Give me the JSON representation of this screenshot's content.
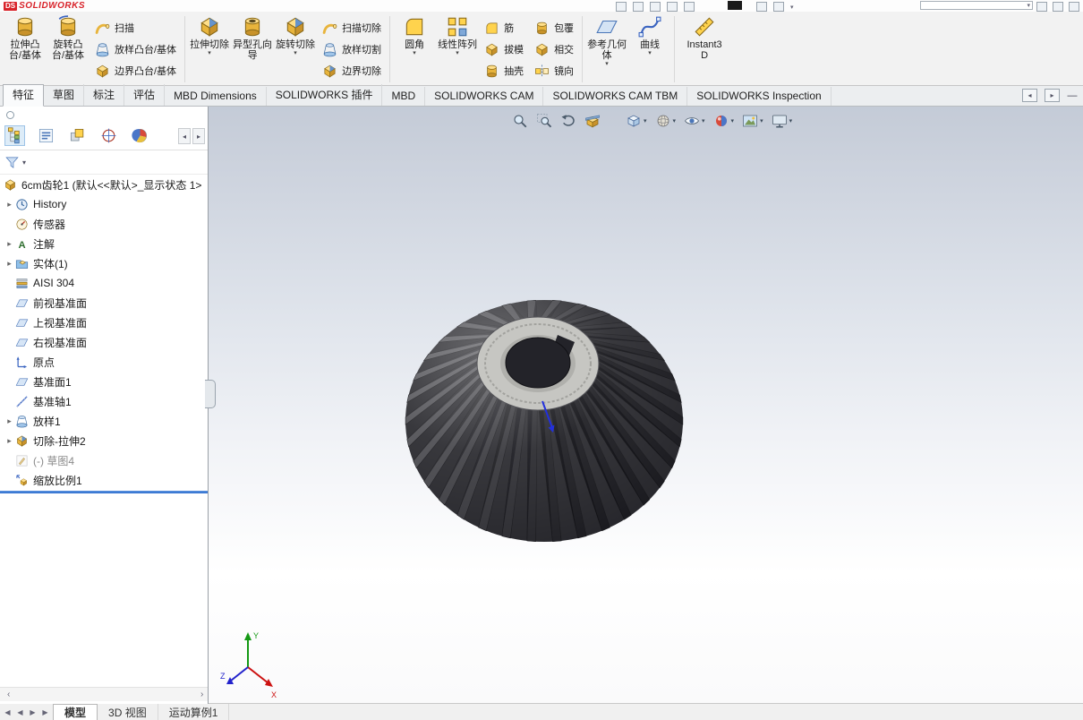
{
  "titlebar": {
    "logo_prefix": "DS",
    "logo": "SOLIDWORKS"
  },
  "ribbon": {
    "buttons": [
      {
        "label": "拉伸凸台/基体"
      },
      {
        "label": "旋转凸台/基体"
      },
      {
        "label": "扫描"
      },
      {
        "label": "放样凸台/基体"
      },
      {
        "label": "边界凸台/基体"
      },
      {
        "label": "拉伸切除"
      },
      {
        "label": "异型孔向导"
      },
      {
        "label": "旋转切除"
      },
      {
        "label": "扫描切除"
      },
      {
        "label": "放样切割"
      },
      {
        "label": "边界切除"
      },
      {
        "label": "圆角"
      },
      {
        "label": "线性阵列"
      },
      {
        "label": "筋"
      },
      {
        "label": "拔模"
      },
      {
        "label": "抽壳"
      },
      {
        "label": "包覆"
      },
      {
        "label": "相交"
      },
      {
        "label": "镜向"
      },
      {
        "label": "参考几何体"
      },
      {
        "label": "曲线"
      },
      {
        "label": "Instant3D"
      }
    ]
  },
  "tabs": {
    "items": [
      "特征",
      "草图",
      "标注",
      "评估",
      "MBD Dimensions",
      "SOLIDWORKS 插件",
      "MBD",
      "SOLIDWORKS CAM",
      "SOLIDWORKS CAM TBM",
      "SOLIDWORKS Inspection"
    ],
    "active": "特征"
  },
  "feature_tree": {
    "root": "6cm齿轮1 (默认<<默认>_显示状态 1>",
    "items": [
      {
        "label": "History"
      },
      {
        "label": "传感器"
      },
      {
        "label": "注解"
      },
      {
        "label": "实体(1)"
      },
      {
        "label": "AISI 304"
      },
      {
        "label": "前视基准面"
      },
      {
        "label": "上视基准面"
      },
      {
        "label": "右视基准面"
      },
      {
        "label": "原点"
      },
      {
        "label": "基准面1"
      },
      {
        "label": "基准轴1"
      },
      {
        "label": "放样1"
      },
      {
        "label": "切除-拉伸2"
      },
      {
        "label": "(-) 草图4"
      },
      {
        "label": "缩放比例1"
      }
    ]
  },
  "statusbar": {
    "tabs": [
      "模型",
      "3D 视图",
      "运动算例1"
    ],
    "active": "模型"
  },
  "triad": {
    "x": "X",
    "y": "Y",
    "z": "Z"
  },
  "viewport": {
    "background_top": "#c4cbd7",
    "background_bottom": "#ffffff",
    "gear_dark": "#27272c",
    "hub_light": "#c6c6c2",
    "sketch_blue": "#2230dd"
  },
  "colors": {
    "logo_red": "#d8232a",
    "rollback_blue": "#2f6fd0"
  },
  "icons": {
    "filter-icon": "funnel",
    "zoom-to-fit-icon": "magnifier",
    "zoom-to-area-icon": "magnifier-rect",
    "previous-view-icon": "undo-arrow",
    "section-view-icon": "cut-cube",
    "view-orientation-icon": "cube",
    "display-style-icon": "sphere",
    "hide-show-items-icon": "eye",
    "edit-appearance-icon": "color-ball",
    "apply-scene-icon": "landscape",
    "view-settings-icon": "monitor",
    "feature-manager-icon": "tree",
    "property-manager-icon": "list",
    "configuration-manager-icon": "stacked-blocks",
    "dimxpert-icon": "crosshair-circle",
    "display-manager-icon": "pie",
    "triad-icon": "xyz-axes"
  }
}
